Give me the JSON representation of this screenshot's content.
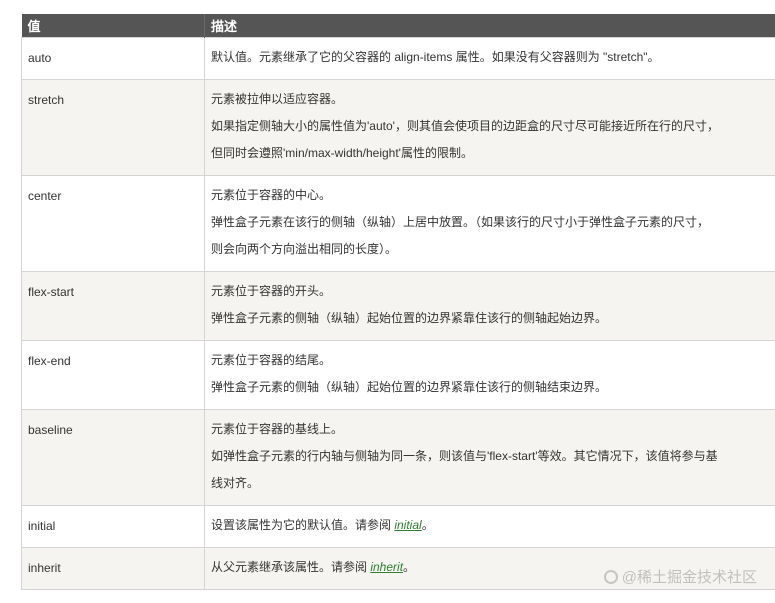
{
  "header": {
    "col_value": "值",
    "col_desc": "描述"
  },
  "rows": [
    {
      "value": "auto",
      "lines": [
        "默认值。元素继承了它的父容器的 align-items 属性。如果没有父容器则为 \"stretch\"。"
      ]
    },
    {
      "value": "stretch",
      "lines": [
        "元素被拉伸以适应容器。",
        "如果指定侧轴大小的属性值为'auto'，则其值会使项目的边距盒的尺寸尽可能接近所在行的尺寸，",
        "但同时会遵照'min/max-width/height'属性的限制。"
      ]
    },
    {
      "value": "center",
      "lines": [
        "元素位于容器的中心。",
        "弹性盒子元素在该行的侧轴（纵轴）上居中放置。（如果该行的尺寸小于弹性盒子元素的尺寸，",
        "则会向两个方向溢出相同的长度）。"
      ]
    },
    {
      "value": "flex-start",
      "lines": [
        "元素位于容器的开头。",
        "弹性盒子元素的侧轴（纵轴）起始位置的边界紧靠住该行的侧轴起始边界。"
      ]
    },
    {
      "value": "flex-end",
      "lines": [
        "元素位于容器的结尾。",
        "弹性盒子元素的侧轴（纵轴）起始位置的边界紧靠住该行的侧轴结束边界。"
      ]
    },
    {
      "value": "baseline",
      "lines": [
        "元素位于容器的基线上。",
        "如弹性盒子元素的行内轴与侧轴为同一条，则该值与'flex-start'等效。其它情况下，该值将参与基",
        "线对齐。"
      ]
    },
    {
      "value": "initial",
      "prefix": "设置该属性为它的默认值。请参阅 ",
      "link": "initial",
      "suffix": "。"
    },
    {
      "value": "inherit",
      "prefix": "从父元素继承该属性。请参阅 ",
      "link": "inherit",
      "suffix": "。"
    }
  ],
  "watermark": {
    "text": "@稀土掘金技术社区",
    "icon": "juejin-logo-icon"
  }
}
